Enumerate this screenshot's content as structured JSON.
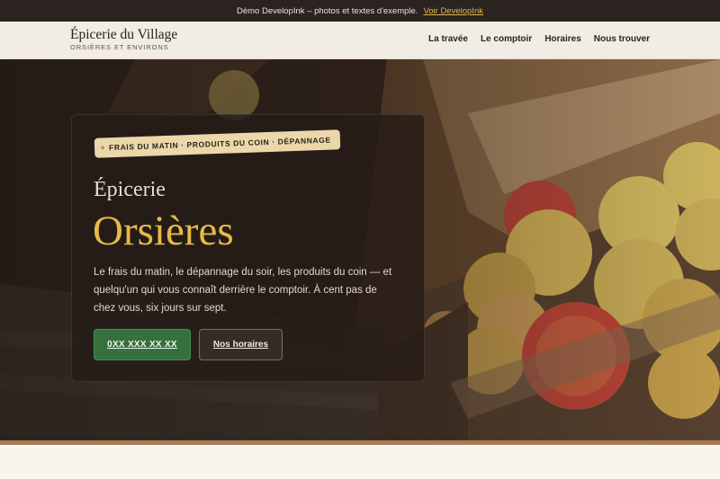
{
  "topbar": {
    "text": "Démo DevelopInk – photos et textes d'exemple.",
    "link": "Voir DevelopInk"
  },
  "brand": {
    "name": "Épicerie du Village",
    "subtitle": "ORSIÈRES ET ENVIRONS"
  },
  "nav": {
    "items": [
      {
        "label": "La travée"
      },
      {
        "label": "Le comptoir"
      },
      {
        "label": "Horaires"
      },
      {
        "label": "Nous trouver"
      }
    ]
  },
  "hero": {
    "tag": "FRAIS DU MATIN · PRODUITS DU COIN · DÉPANNAGE",
    "kicker": "Épicerie",
    "title": "Orsières",
    "description": "Le frais du matin, le dépannage du soir, les produits du coin — et quelqu'un qui vous connaît derrière le comptoir. À cent pas de chez vous, six jours sur sept.",
    "primary_button": "0XX XXX XX XX",
    "secondary_button": "Nos horaires",
    "photo_icon": "apple-crate-photo"
  },
  "colors": {
    "accent": "#e7b948",
    "primary": "#35713f",
    "topbar": "#2a2320"
  }
}
